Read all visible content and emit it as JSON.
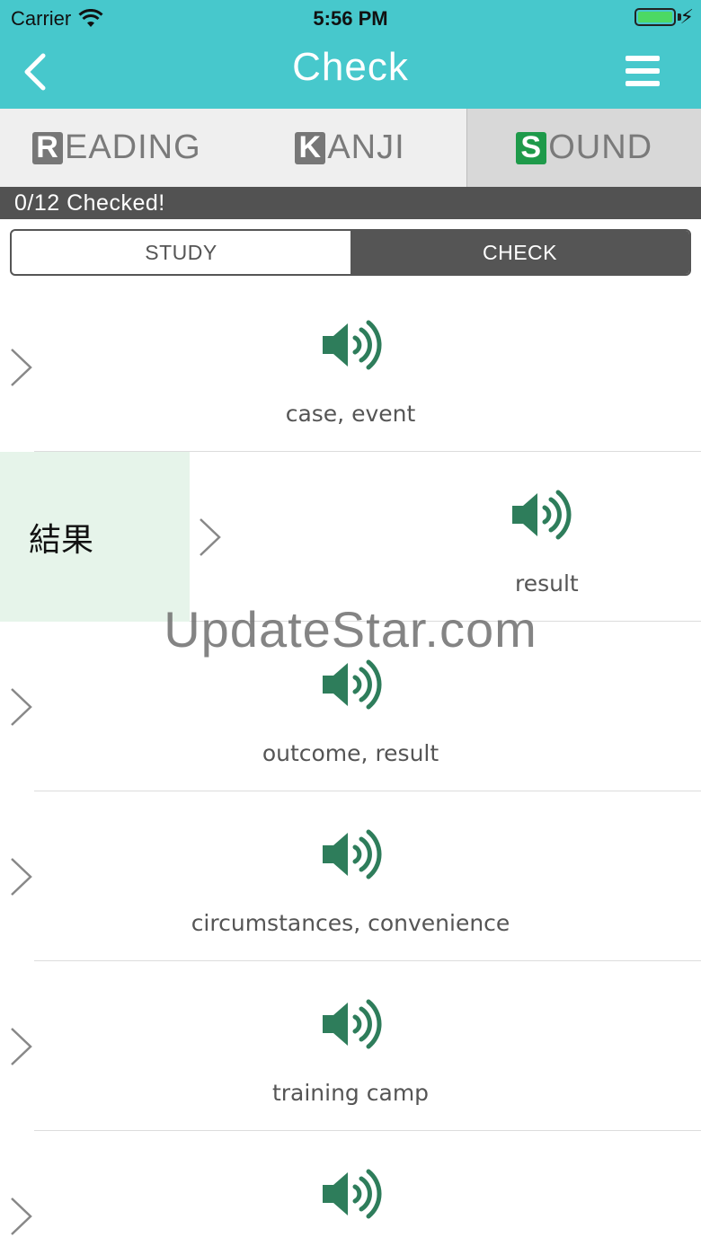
{
  "status_bar": {
    "carrier": "Carrier",
    "time": "5:56 PM"
  },
  "nav": {
    "title": "Check"
  },
  "category_tabs": [
    {
      "letter": "R",
      "rest": "EADING",
      "active": false
    },
    {
      "letter": "K",
      "rest": "ANJI",
      "active": false
    },
    {
      "letter": "S",
      "rest": "OUND",
      "active": true
    }
  ],
  "progress": {
    "checked_text": "0/12 Checked!"
  },
  "segment": {
    "study_label": "STUDY",
    "check_label": "CHECK",
    "selected": "CHECK"
  },
  "rows": [
    {
      "meaning": "case, event"
    },
    {
      "meaning": "result",
      "revealed_kanji": "結果"
    },
    {
      "meaning": "outcome, result"
    },
    {
      "meaning": "circumstances, convenience"
    },
    {
      "meaning": "training camp"
    },
    {
      "meaning": ""
    }
  ],
  "watermark": "UpdateStar.com",
  "colors": {
    "nav_bg": "#47c8cc",
    "speaker": "#2e7d5b",
    "active_letter": "#1e9a4a",
    "reveal_bg": "#e6f4ea"
  }
}
